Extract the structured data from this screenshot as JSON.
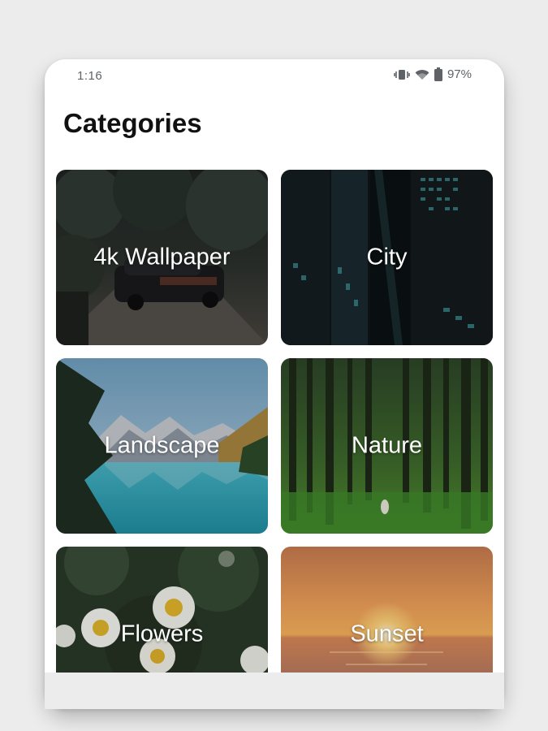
{
  "status_bar": {
    "time": "1:16",
    "battery": "97%",
    "icons": [
      "vibrate-icon",
      "wifi-icon",
      "battery-icon"
    ]
  },
  "page": {
    "title": "Categories"
  },
  "categories": [
    {
      "label": "4k Wallpaper"
    },
    {
      "label": "City"
    },
    {
      "label": "Landscape"
    },
    {
      "label": "Nature"
    },
    {
      "label": "Flowers"
    },
    {
      "label": "Sunset"
    }
  ]
}
